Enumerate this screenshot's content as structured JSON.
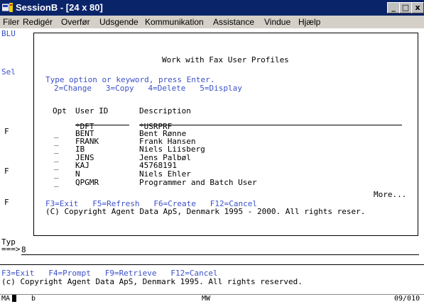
{
  "window": {
    "title": "SessionB - [24 x 80]",
    "buttons": [
      "_",
      "□",
      "x"
    ]
  },
  "menu": [
    "Filer",
    "Redigér",
    "Overfør",
    "Udsgende",
    "Kommunikation",
    "Assistance",
    "Vindue",
    "Hjælp"
  ],
  "background": {
    "blu": "BLU",
    "sel": "Sel",
    "f_markers": [
      "F",
      "F",
      "F"
    ],
    "typ": "Typ",
    "prompt": "===>",
    "command_value": "8",
    "fkeys": "F3=Exit   F4=Prompt   F9=Retrieve   F12=Cancel",
    "copyright": "(c) Copyright Agent Data ApS, Denmark 1995. All rights reserved."
  },
  "dialog": {
    "title": "Work with Fax User Profiles",
    "instruction": "Type option or keyword, press Enter.",
    "options": "2=Change   3=Copy   4=Delete   5=Display",
    "col_opt": "Opt",
    "col_user": "User ID",
    "col_desc": "Description",
    "rows": [
      {
        "opt": "",
        "user": "*DFT",
        "desc": "*USRPRF"
      },
      {
        "opt": "_",
        "user": "BENT",
        "desc": "Bent Rønne"
      },
      {
        "opt": "_",
        "user": "FRANK",
        "desc": "Frank Hansen"
      },
      {
        "opt": "_",
        "user": "IB",
        "desc": "Niels Liisberg"
      },
      {
        "opt": "_",
        "user": "JENS",
        "desc": "Jens Palbøl"
      },
      {
        "opt": "_",
        "user": "KAJ",
        "desc": "45768191"
      },
      {
        "opt": "_",
        "user": "N",
        "desc": "Niels Ehler"
      },
      {
        "opt": "_",
        "user": "QPGMR",
        "desc": "Programmer and Batch User"
      }
    ],
    "more": "More...",
    "fkeys": "F3=Exit   F5=Refresh   F6=Create   F12=Cancel",
    "copyright": "(C) Copyright Agent Data ApS, Denmark 1995 - 2000. All rights reser."
  },
  "statusbar": {
    "mode": "MA",
    "session": "b",
    "mw": "MW",
    "position": "09/010"
  }
}
